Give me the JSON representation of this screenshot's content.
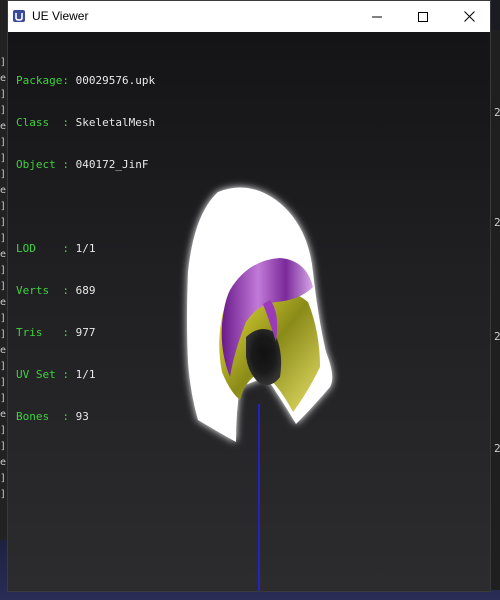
{
  "window": {
    "title": "UE Viewer"
  },
  "controls": {
    "minimize": "—",
    "maximize": "☐",
    "close": "✕"
  },
  "info": {
    "package": {
      "label": "Package:",
      "value": "00029576.upk"
    },
    "class": {
      "label": "Class  :",
      "value": "SkeletalMesh"
    },
    "object": {
      "label": "Object :",
      "value": "040172_JinF"
    },
    "lod": {
      "label": "LOD    :",
      "value": "1/1"
    },
    "verts": {
      "label": "Verts  :",
      "value": "689"
    },
    "tris": {
      "label": "Tris   :",
      "value": "977"
    },
    "uvset": {
      "label": "UV Set :",
      "value": "1/1"
    },
    "bones": {
      "label": "Bones  :",
      "value": "93"
    }
  },
  "background": {
    "left_marks": [
      "]",
      "e",
      "]",
      "]",
      "e",
      "]",
      "]",
      "]",
      "e",
      "]",
      "]",
      "]",
      "e",
      "]",
      "]",
      "e",
      "]",
      "]",
      "e",
      "]",
      "]",
      "]",
      "e",
      "]",
      "]",
      "e",
      "]",
      "]"
    ],
    "right_marks": [
      "2",
      "2",
      "2",
      "2"
    ]
  },
  "colors": {
    "label": "#3fd13f",
    "value": "#e8e8e8",
    "mesh_outer": "#ffffff",
    "hair": "#8a2aa8",
    "lining": "#d8cc22",
    "bone": "#2222ee"
  }
}
